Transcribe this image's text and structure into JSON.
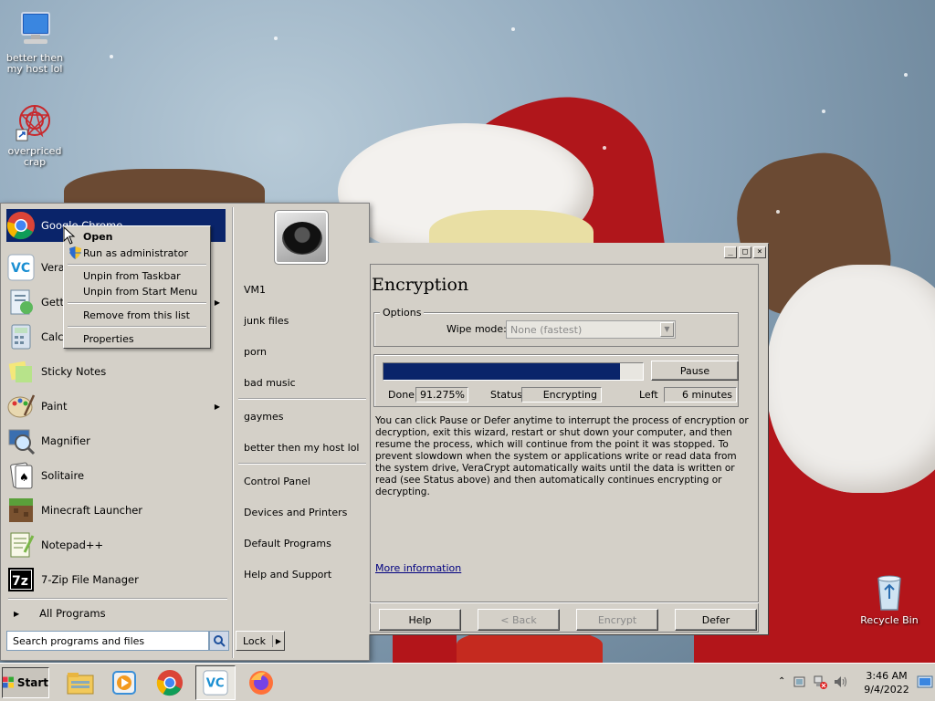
{
  "desktop": {
    "icons": [
      {
        "label": "better then my host lol",
        "icon": "computer-icon"
      },
      {
        "label": "overpriced crap",
        "icon": "shortcut-icon"
      },
      {
        "label": "Recycle Bin",
        "icon": "recycle-bin-icon"
      }
    ]
  },
  "start_menu": {
    "pinned": [
      {
        "label": "Google Chrome",
        "icon": "chrome-icon"
      },
      {
        "label": "VeraCrypt",
        "icon": "veracrypt-icon"
      },
      {
        "label": "Getting Started",
        "icon": "getting-started-icon"
      },
      {
        "label": "Calculator",
        "icon": "calculator-icon"
      },
      {
        "label": "Sticky Notes",
        "icon": "sticky-notes-icon"
      },
      {
        "label": "Paint",
        "icon": "paint-icon"
      },
      {
        "label": "Magnifier",
        "icon": "magnifier-icon"
      },
      {
        "label": "Solitaire",
        "icon": "solitaire-icon"
      },
      {
        "label": "Minecraft Launcher",
        "icon": "minecraft-icon"
      },
      {
        "label": "Notepad++",
        "icon": "notepadpp-icon"
      },
      {
        "label": "7-Zip File Manager",
        "icon": "7zip-icon"
      }
    ],
    "visible_labels": {
      "chrome": "Google Chrome",
      "veracrypt": "Vera",
      "getting_started": "Gett",
      "calculator": "Calc"
    },
    "all_programs": "All Programs",
    "search_placeholder": "Search programs and files",
    "right_items": [
      "VM1",
      "junk files",
      "porn",
      "bad music",
      "gaymes",
      "better then my host lol",
      "Control Panel",
      "Devices and Printers",
      "Default Programs",
      "Help and Support"
    ],
    "lock_label": "Lock"
  },
  "context_menu": {
    "items": [
      "Open",
      "Run as administrator",
      "Unpin from Taskbar",
      "Unpin from Start Menu",
      "Remove from this list",
      "Properties"
    ]
  },
  "veracrypt": {
    "title": "Encryption",
    "options_label": "Options",
    "wipe_mode_label": "Wipe mode:",
    "wipe_mode_value": "None (fastest)",
    "progress_fraction": 0.91275,
    "pause_label": "Pause",
    "done_label": "Done",
    "done_value": "91.275%",
    "status_label": "Status",
    "status_value": "Encrypting",
    "left_label": "Left",
    "left_value": "6 minutes",
    "info_text": "You can click Pause or Defer anytime to interrupt the process of encryption or decryption, exit this wizard, restart or shut down your computer, and then resume the process, which will continue from the point it was stopped. To prevent slowdown when the system or applications write or read data from the system drive, VeraCrypt automatically waits until the data is written or read (see Status above) and then automatically continues encrypting or decrypting.",
    "more_info": "More information",
    "buttons": {
      "help": "Help",
      "back": "< Back",
      "encrypt": "Encrypt",
      "defer": "Defer"
    }
  },
  "taskbar": {
    "start_label": "Start",
    "apps": [
      "explorer-icon",
      "media-player-icon",
      "chrome-icon",
      "veracrypt-icon",
      "firefox-icon"
    ],
    "time": "3:46 AM",
    "date": "9/4/2022"
  }
}
